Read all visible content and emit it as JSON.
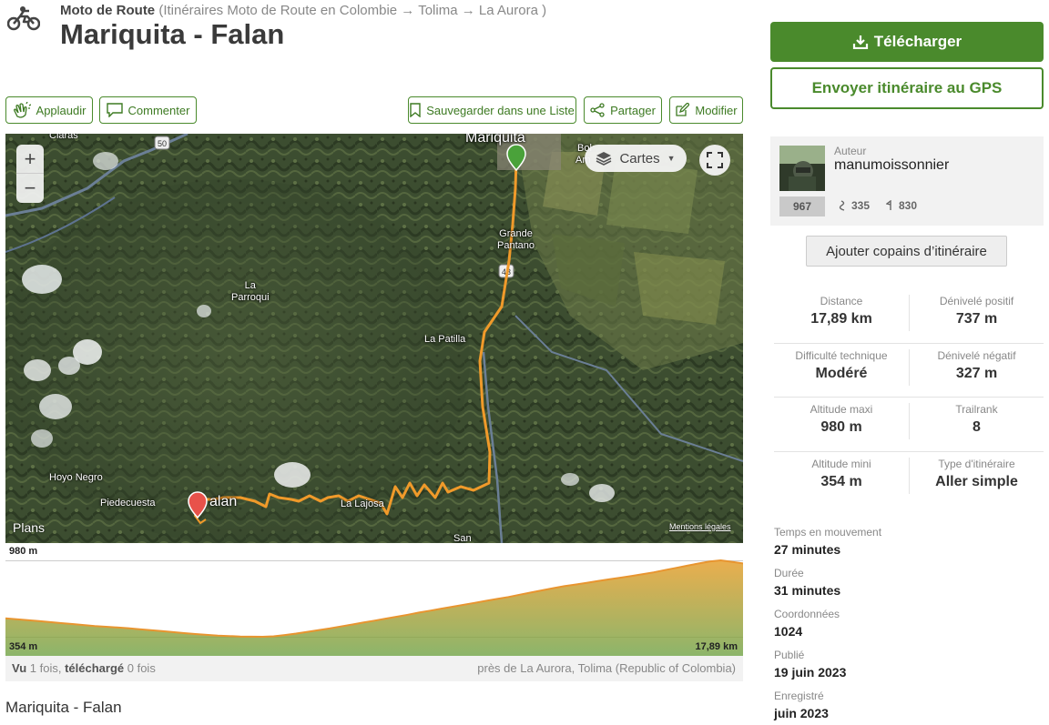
{
  "header": {
    "category": "Moto de Route",
    "breadcrumb": "(Itinéraires Moto de Route en Colombie → Tolima → La Aurora )",
    "title": "Mariquita - Falan"
  },
  "actions": {
    "applaud": "Applaudir",
    "comment": "Commenter",
    "save_list": "Sauvegarder dans une Liste",
    "share": "Partager",
    "edit": "Modifier"
  },
  "map": {
    "zoom_in": "+",
    "zoom_out": "−",
    "layers_label": "Cartes",
    "provider": "Plans",
    "legal": "Mentions légales",
    "places": {
      "mariquita": "Mariquita",
      "claras": "Claras",
      "bol": "Bol",
      "am": "Am",
      "grande_pantano": "Grande\nPantano",
      "la_parroqui": "La\nParroqui",
      "la_patilla": "La Patilla",
      "hoyo_negro": "Hoyo Negro",
      "piedecuesta": "Piedecuesta",
      "falan": "alan",
      "la_lajosa": "La Lajosa",
      "san": "San"
    },
    "road_shields": {
      "r50": "50",
      "r43": "43"
    }
  },
  "elevation": {
    "max_label": "980 m",
    "min_label": "354 m",
    "distance_label": "17,89 km",
    "profile_m": [
      505,
      498,
      490,
      482,
      474,
      466,
      458,
      450,
      442,
      436,
      430,
      424,
      416,
      408,
      400,
      392,
      384,
      376,
      370,
      364,
      360,
      356,
      355,
      354,
      358,
      368,
      380,
      394,
      408,
      422,
      438,
      454,
      470,
      486,
      502,
      518,
      534,
      552,
      568,
      584,
      600,
      616,
      632,
      648,
      664,
      680,
      698,
      716,
      734,
      752,
      768,
      782,
      796,
      810,
      824,
      838,
      852,
      866,
      882,
      900,
      918,
      936,
      954,
      970,
      980,
      968,
      955
    ],
    "fill_top": "#e8a53a",
    "fill_bottom": "#7fad5a",
    "line": "#e89530"
  },
  "stats_bar": {
    "seen_label": "Vu",
    "seen_text": "1 fois,",
    "downloaded_label": "téléchargé",
    "downloaded_text": "0 fois",
    "location": "près de La Aurora, Tolima (Republic of Colombia)"
  },
  "bottom_title": "Mariquita - Falan",
  "sidebar": {
    "download": "Télécharger",
    "send_gps": "Envoyer itinéraire au GPS",
    "author_caption": "Auteur",
    "author_name": "manumoissonnier",
    "points": "967",
    "trails_count": "335",
    "flags_count": "830",
    "add_buddies": "Ajouter copains d’itinéraire",
    "stats": [
      {
        "left_cap": "Distance",
        "left_val": "17,89 km",
        "right_cap": "Dénivelé positif",
        "right_val": "737 m"
      },
      {
        "left_cap": "Difficulté technique",
        "left_val": "Modéré",
        "right_cap": "Dénivelé négatif",
        "right_val": "327 m"
      },
      {
        "left_cap": "Altitude maxi",
        "left_val": "980 m",
        "right_cap": "Trailrank",
        "right_val": "8"
      },
      {
        "left_cap": "Altitude mini",
        "left_val": "354 m",
        "right_cap": "Type d'itinéraire",
        "right_val": "Aller simple"
      }
    ],
    "info": [
      {
        "cap": "Temps en mouvement",
        "val": "27 minutes"
      },
      {
        "cap": "Durée",
        "val": "31 minutes"
      },
      {
        "cap": "Coordonnées",
        "val": "1024"
      },
      {
        "cap": "Publié",
        "val": "19 juin 2023"
      },
      {
        "cap": "Enregistré",
        "val": "juin 2023"
      }
    ]
  },
  "colors": {
    "brand_green": "#4a8a2c",
    "route": "#f09a2a",
    "start_pin": "#4aa23a",
    "end_pin": "#e8524a"
  }
}
